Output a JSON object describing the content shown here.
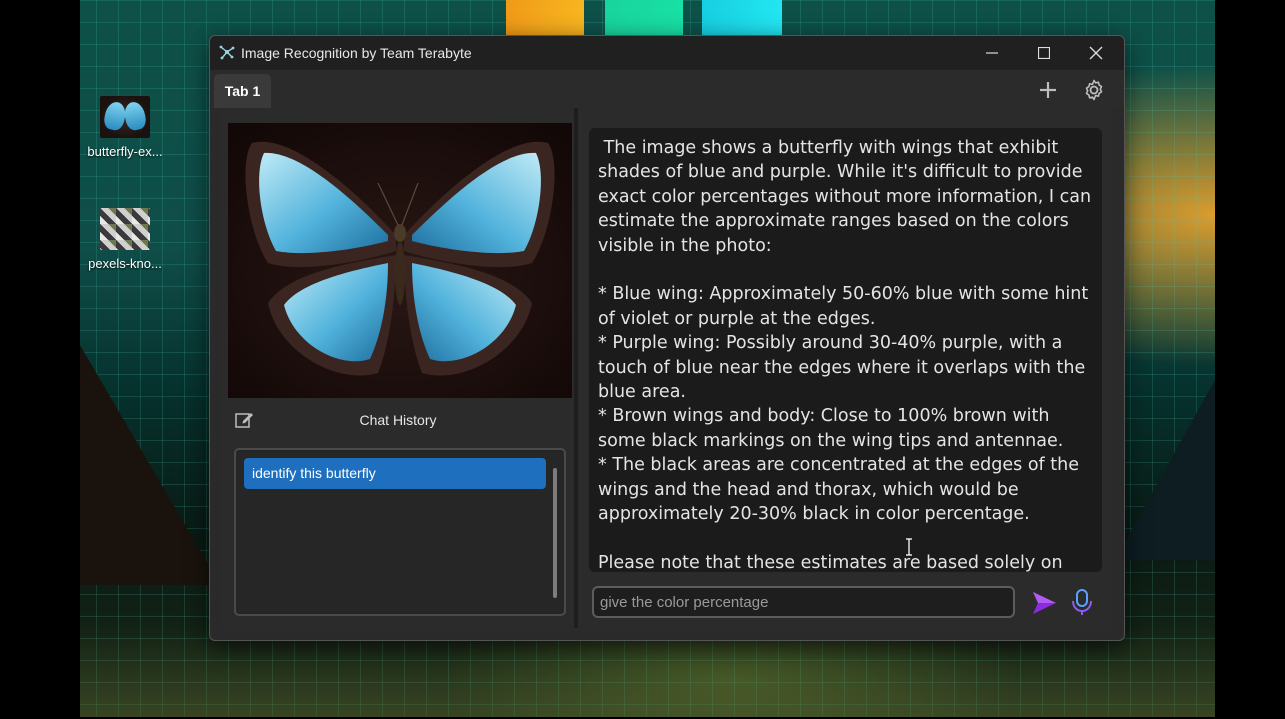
{
  "desktop": {
    "icons": [
      {
        "label": "butterfly-ex...",
        "icon": "butterfly-image-thumbnail-icon"
      },
      {
        "label": "pexels-kno...",
        "icon": "pexels-image-thumbnail-icon"
      }
    ]
  },
  "window": {
    "title": "Image Recognition by Team Terabyte",
    "controls": [
      "minimize",
      "maximize",
      "close"
    ]
  },
  "tabs": [
    {
      "label": "Tab 1",
      "active": true
    }
  ],
  "left_panel": {
    "chat_history_title": "Chat History",
    "history": [
      "identify this butterfly"
    ],
    "selected_index": 0
  },
  "response": {
    "text": " The image shows a butterfly with wings that exhibit shades of blue and purple. While it's difficult to provide exact color percentages without more information, I can estimate the approximate ranges based on the colors visible in the photo:\n\n* Blue wing: Approximately 50-60% blue with some hint of violet or purple at the edges.\n* Purple wing: Possibly around 30-40% purple, with a touch of blue near the edges where it overlaps with the blue area.\n* Brown wings and body: Close to 100% brown with some black markings on the wing tips and antennae.\n* The black areas are concentrated at the edges of the wings and the head and thorax, which would be approximately 20-30% black in color percentage.\n\nPlease note that these estimates are based solely on visual observation and may not be entirely accurate without more i"
  },
  "input": {
    "value": "give the color percentage"
  },
  "colors": {
    "accent_selected": "#1f6fbf",
    "send_icon": "#8a2be2",
    "window_bg": "#2a2a2a"
  }
}
